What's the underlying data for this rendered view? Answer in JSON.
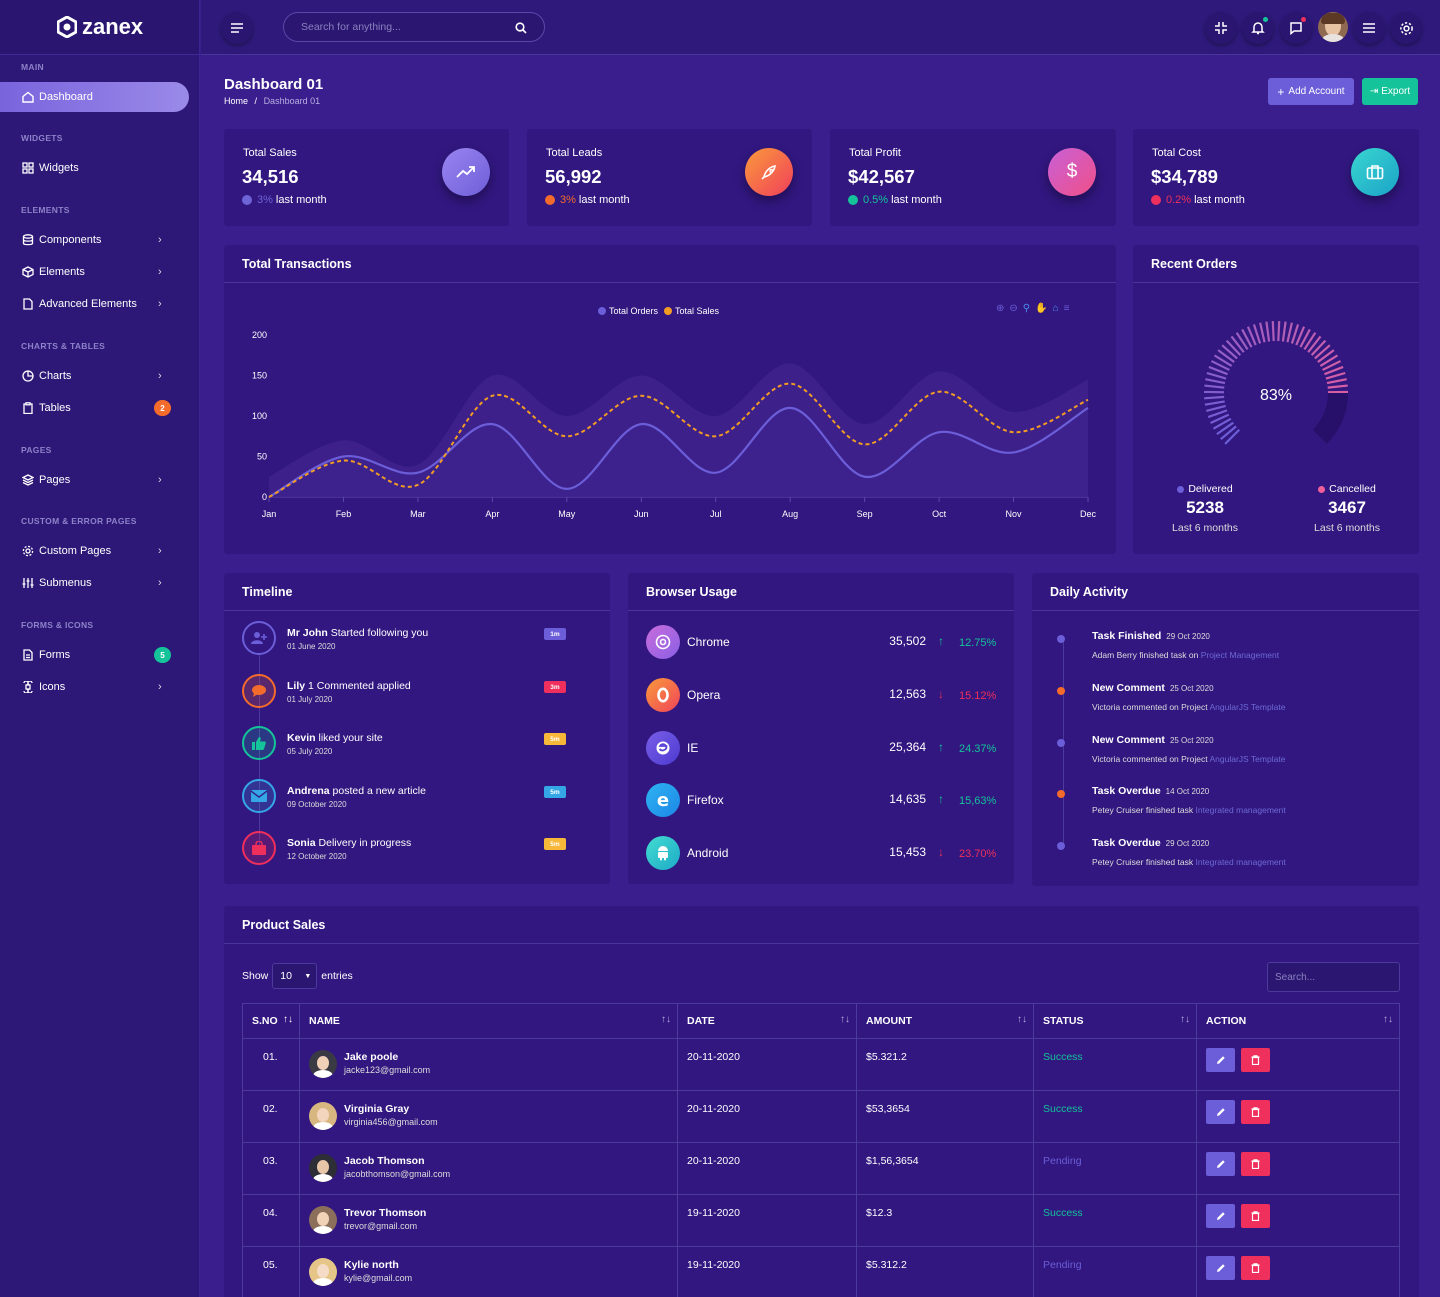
{
  "brand": {
    "name": "zanex"
  },
  "sidebar": {
    "sections": [
      "MAIN",
      "WIDGETS",
      "ELEMENTS",
      "CHARTS & TABLES",
      "PAGES",
      "CUSTOM & ERROR PAGES",
      "FORMS & ICONS"
    ],
    "items": [
      {
        "label": "Dashboard",
        "icon": "home-icon"
      },
      {
        "label": "Widgets",
        "icon": "grid-icon"
      },
      {
        "label": "Components",
        "icon": "database-icon"
      },
      {
        "label": "Elements",
        "icon": "package-icon"
      },
      {
        "label": "Advanced Elements",
        "icon": "file-icon"
      },
      {
        "label": "Charts",
        "icon": "pie-chart-icon"
      },
      {
        "label": "Tables",
        "icon": "clipboard-icon",
        "badge": "2"
      },
      {
        "label": "Pages",
        "icon": "layers-icon"
      },
      {
        "label": "Custom Pages",
        "icon": "settings-icon"
      },
      {
        "label": "Submenus",
        "icon": "sliders-icon"
      },
      {
        "label": "Forms",
        "icon": "file-text-icon",
        "badge": "5"
      },
      {
        "label": "Icons",
        "icon": "command-icon"
      }
    ]
  },
  "header": {
    "search_placeholder": "Search for anything..."
  },
  "page": {
    "title": "Dashboard 01",
    "breadcrumb": [
      "Home",
      "Dashboard 01"
    ],
    "add_account": "Add Account",
    "export": "Export"
  },
  "stats": [
    {
      "label": "Total Sales",
      "value": "34,516",
      "pct": "3%",
      "suffix": "last month",
      "color": "#6f63d8"
    },
    {
      "label": "Total Leads",
      "value": "56,992",
      "pct": "3%",
      "suffix": "last month",
      "color": "#f46b2b"
    },
    {
      "label": "Total Profit",
      "value": "$42,567",
      "pct": "0.5%",
      "suffix": "last month",
      "color": "#15c39a"
    },
    {
      "label": "Total Cost",
      "value": "$34,789",
      "pct": "0.2%",
      "suffix": "last month",
      "color": "#ef2f5c"
    }
  ],
  "transactions": {
    "title": "Total Transactions"
  },
  "chart_data": {
    "type": "line",
    "categories": [
      "Jan",
      "Feb",
      "Mar",
      "Apr",
      "May",
      "Jun",
      "Jul",
      "Aug",
      "Sep",
      "Oct",
      "Nov",
      "Dec"
    ],
    "series": [
      {
        "name": "Total Orders",
        "values": [
          0,
          50,
          30,
          90,
          10,
          90,
          30,
          110,
          25,
          80,
          55,
          110
        ],
        "color": "#6b5ed8"
      },
      {
        "name": "Total Sales",
        "values": [
          0,
          45,
          15,
          125,
          75,
          125,
          75,
          140,
          65,
          130,
          80,
          120
        ],
        "color": "#f29c24"
      }
    ],
    "ylim": [
      0,
      200
    ],
    "yticks": [
      0,
      50,
      100,
      150,
      200
    ]
  },
  "recent_orders": {
    "title": "Recent Orders",
    "percent": "83%",
    "delivered_label": "Delivered",
    "delivered": "5238",
    "cancelled_label": "Cancelled",
    "cancelled": "3467",
    "period": "Last 6 months"
  },
  "timeline": {
    "title": "Timeline",
    "items": [
      {
        "name": "Mr John",
        "text": "Started following you",
        "date": "01 June 2020",
        "badge": "1m",
        "color": "#6b5ed8",
        "bcolor": "#6b5ed8"
      },
      {
        "name": "Lily",
        "text": "1 Commented applied",
        "date": "01 July 2020",
        "badge": "3m",
        "color": "#f46b2b",
        "bcolor": "#ef2f5c"
      },
      {
        "name": "Kevin",
        "text": "liked your site",
        "date": "05 July 2020",
        "badge": "5m",
        "color": "#15c39a",
        "bcolor": "#f7b83a"
      },
      {
        "name": "Andrena",
        "text": "posted a new article",
        "date": "09 October 2020",
        "badge": "5m",
        "color": "#35a7e6",
        "bcolor": "#35a7e6"
      },
      {
        "name": "Sonia",
        "text": "Delivery in progress",
        "date": "12 October 2020",
        "badge": "5m",
        "color": "#ef2f5c",
        "bcolor": "#f7b83a"
      }
    ]
  },
  "browser": {
    "title": "Browser Usage",
    "items": [
      {
        "name": "Chrome",
        "value": "35,502",
        "pct": "12.75%",
        "dir": "up"
      },
      {
        "name": "Opera",
        "value": "12,563",
        "pct": "15.12%",
        "dir": "down"
      },
      {
        "name": "IE",
        "value": "25,364",
        "pct": "24.37%",
        "dir": "up"
      },
      {
        "name": "Firefox",
        "value": "14,635",
        "pct": "15,63%",
        "dir": "up"
      },
      {
        "name": "Android",
        "value": "15,453",
        "pct": "23.70%",
        "dir": "down"
      }
    ]
  },
  "activity": {
    "title": "Daily Activity",
    "items": [
      {
        "title": "Task Finished",
        "date": "29 Oct 2020",
        "text": "Adam Berry finished task on",
        "link": "Project Management"
      },
      {
        "title": "New Comment",
        "date": "25 Oct 2020",
        "text": "Victoria commented on Project",
        "link": "AngularJS Template"
      },
      {
        "title": "New Comment",
        "date": "25 Oct 2020",
        "text": "Victoria commented on Project",
        "link": "AngularJS Template"
      },
      {
        "title": "Task Overdue",
        "date": "14 Oct 2020",
        "text": "Petey Cruiser finished task",
        "link": "Integrated management"
      },
      {
        "title": "Task Overdue",
        "date": "29 Oct 2020",
        "text": "Petey Cruiser finished task",
        "link": "Integrated management"
      }
    ]
  },
  "products": {
    "title": "Product Sales",
    "show": "Show",
    "entries_value": "10",
    "entries": "entries",
    "search_placeholder": "Search...",
    "columns": [
      "S.NO",
      "NAME",
      "DATE",
      "AMOUNT",
      "STATUS",
      "ACTION"
    ],
    "rows": [
      {
        "no": "01.",
        "name": "Jake poole",
        "email": "jacke123@gmail.com",
        "date": "20-11-2020",
        "amount": "$5.321.2",
        "status": "Success"
      },
      {
        "no": "02.",
        "name": "Virginia Gray",
        "email": "virginia456@gmail.com",
        "date": "20-11-2020",
        "amount": "$53,3654",
        "status": "Success"
      },
      {
        "no": "03.",
        "name": "Jacob Thomson",
        "email": "jacobthomson@gmail.com",
        "date": "20-11-2020",
        "amount": "$1,56,3654",
        "status": "Pending"
      },
      {
        "no": "04.",
        "name": "Trevor Thomson",
        "email": "trevor@gmail.com",
        "date": "19-11-2020",
        "amount": "$12.3",
        "status": "Success"
      },
      {
        "no": "05.",
        "name": "Kylie north",
        "email": "kylie@gmail.com",
        "date": "19-11-2020",
        "amount": "$5.312.2",
        "status": "Pending"
      }
    ]
  }
}
